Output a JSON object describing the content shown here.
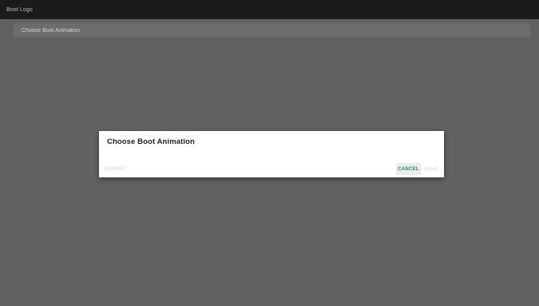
{
  "app_bar": {
    "title": "Boot Logo"
  },
  "list": {
    "items": [
      {
        "label": "Choose Boot Animation"
      }
    ]
  },
  "dialog": {
    "title": "Choose Boot Animation",
    "buttons": {
      "forget": "FORGET",
      "cancel": "CANCEL",
      "save": "SAVE"
    }
  },
  "colors": {
    "accent": "#1a8a80",
    "app_bar": "#1b1b1b",
    "scrim": "#616161"
  }
}
